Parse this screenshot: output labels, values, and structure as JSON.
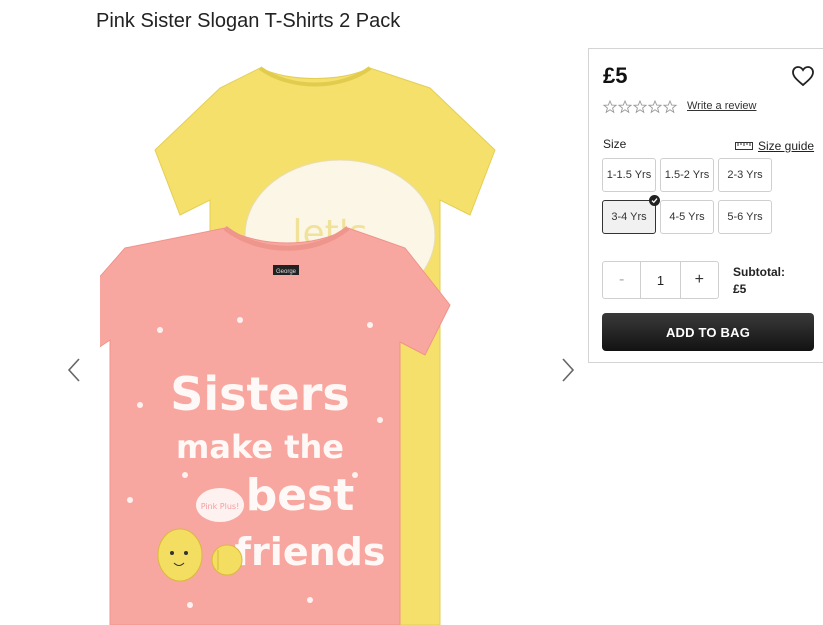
{
  "product": {
    "title": "Pink Sister Slogan T-Shirts 2 Pack",
    "image_alt": "Pink and yellow t-shirts",
    "print": {
      "line1": "Sisters",
      "line2": "make the",
      "line3": "best",
      "line4": "friends",
      "badge": "Pink Plus!",
      "back_print": "let's"
    },
    "label": "George"
  },
  "purchase": {
    "price": "£5",
    "rating_stars": 0,
    "review_link": "Write a review",
    "size_label": "Size",
    "size_guide": "Size guide",
    "sizes": [
      {
        "label": "1-1.5 Yrs",
        "selected": false
      },
      {
        "label": "1.5-2 Yrs",
        "selected": false
      },
      {
        "label": "2-3 Yrs",
        "selected": false
      },
      {
        "label": "3-4 Yrs",
        "selected": true
      },
      {
        "label": "4-5 Yrs",
        "selected": false
      },
      {
        "label": "5-6 Yrs",
        "selected": false
      }
    ],
    "quantity": "1",
    "minus": "-",
    "plus": "+",
    "subtotal_label": "Subtotal:",
    "subtotal_value": "£5",
    "add_to_bag": "ADD TO BAG"
  },
  "colors": {
    "pink_shirt": "#f8a7a0",
    "yellow_shirt": "#f4e06a",
    "button_dark": "#1e1e1e"
  }
}
